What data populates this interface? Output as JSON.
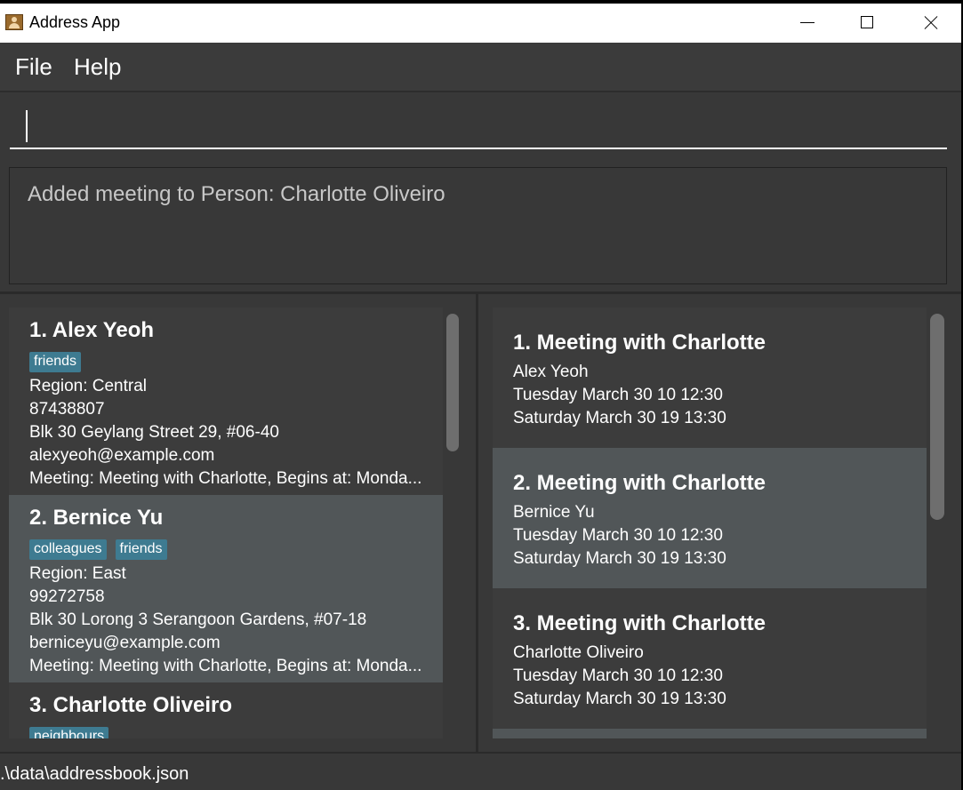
{
  "window": {
    "title": "Address App"
  },
  "menu": {
    "file": "File",
    "help": "Help"
  },
  "command": {
    "value": ""
  },
  "result": {
    "message": "Added meeting to Person: Charlotte Oliveiro"
  },
  "persons": [
    {
      "title": "1.  Alex Yeoh",
      "tags": [
        "friends"
      ],
      "region": "Region: Central",
      "phone": "87438807",
      "address": "Blk 30 Geylang Street 29, #06-40",
      "email": "alexyeoh@example.com",
      "meeting": "Meeting: Meeting with Charlotte, Begins at: Monda..."
    },
    {
      "title": "2.  Bernice Yu",
      "tags": [
        "colleagues",
        "friends"
      ],
      "region": "Region: East",
      "phone": "99272758",
      "address": "Blk 30 Lorong 3 Serangoon Gardens, #07-18",
      "email": "berniceyu@example.com",
      "meeting": "Meeting: Meeting with Charlotte, Begins at: Monda..."
    },
    {
      "title": "3.  Charlotte Oliveiro",
      "tags": [
        "neighbours"
      ]
    }
  ],
  "meetings": [
    {
      "title": "1.  Meeting with Charlotte",
      "person": "Alex Yeoh",
      "start": "Tuesday March 30 10 12:30",
      "end": "Saturday March 30 19 13:30"
    },
    {
      "title": "2.  Meeting with Charlotte",
      "person": "Bernice Yu",
      "start": "Tuesday March 30 10 12:30",
      "end": "Saturday March 30 19 13:30"
    },
    {
      "title": "3.  Meeting with Charlotte",
      "person": "Charlotte Oliveiro",
      "start": "Tuesday March 30 10 12:30",
      "end": "Saturday March 30 19 13:30"
    }
  ],
  "status": {
    "file_path": ".\\data\\addressbook.json"
  }
}
